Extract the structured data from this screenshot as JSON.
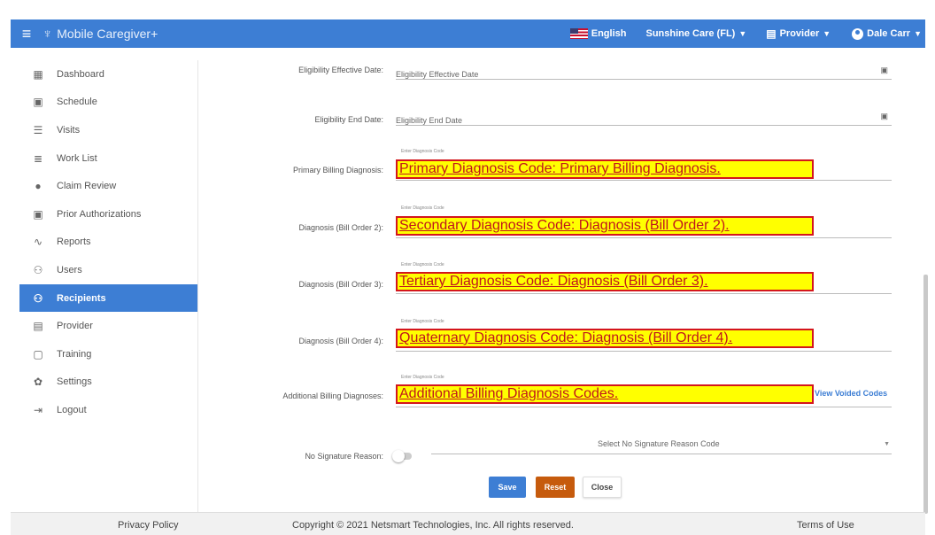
{
  "app": {
    "title": "Mobile Caregiver+"
  },
  "topbar": {
    "language": "English",
    "agency": "Sunshine Care (FL)",
    "role": "Provider",
    "user": "Dale Carr"
  },
  "sidebar": {
    "items": [
      {
        "label": "Dashboard",
        "icon": "dashboard-icon"
      },
      {
        "label": "Schedule",
        "icon": "calendar-icon"
      },
      {
        "label": "Visits",
        "icon": "filter-icon"
      },
      {
        "label": "Work List",
        "icon": "list-icon"
      },
      {
        "label": "Claim Review",
        "icon": "alert-icon"
      },
      {
        "label": "Prior Authorizations",
        "icon": "calendar-check-icon"
      },
      {
        "label": "Reports",
        "icon": "trend-icon"
      },
      {
        "label": "Users",
        "icon": "users-icon"
      },
      {
        "label": "Recipients",
        "icon": "recipients-icon",
        "active": true
      },
      {
        "label": "Provider",
        "icon": "clipboard-icon"
      },
      {
        "label": "Training",
        "icon": "training-icon"
      },
      {
        "label": "Settings",
        "icon": "gear-icon"
      },
      {
        "label": "Logout",
        "icon": "logout-icon"
      }
    ]
  },
  "form": {
    "eligibility_effective": {
      "label": "Eligibility Effective Date:",
      "placeholder": "Eligibility Effective Date"
    },
    "eligibility_end": {
      "label": "Eligibility End Date:",
      "placeholder": "Eligibility End Date"
    },
    "diag_hint": "Enter Diagnosis Code",
    "primary": {
      "label": "Primary Billing Diagnosis:",
      "note": "Primary Diagnosis Code: Primary Billing Diagnosis."
    },
    "diag2": {
      "label": "Diagnosis (Bill Order 2):",
      "note": "Secondary Diagnosis Code: Diagnosis (Bill Order 2)."
    },
    "diag3": {
      "label": "Diagnosis (Bill Order 3):",
      "note": "Tertiary Diagnosis Code: Diagnosis (Bill Order 3)."
    },
    "diag4": {
      "label": "Diagnosis (Bill Order 4):",
      "note": "Quaternary Diagnosis Code: Diagnosis (Bill Order 4)."
    },
    "additional": {
      "label": "Additional Billing Diagnoses:",
      "note": "Additional Billing Diagnosis Codes.",
      "link": "View Voided Codes"
    },
    "no_signature": {
      "label": "No Signature Reason:",
      "placeholder": "Select No Signature Reason Code",
      "toggle_on": false
    }
  },
  "buttons": {
    "save": "Save",
    "reset": "Reset",
    "close": "Close"
  },
  "footer": {
    "privacy": "Privacy Policy",
    "copyright": "Copyright © 2021 Netsmart Technologies, Inc. All rights reserved.",
    "terms": "Terms of Use"
  },
  "colors": {
    "primary": "#3d7ed4",
    "reset": "#c65b0d",
    "highlight": "#ffff00",
    "highlight_border": "#d4161c"
  }
}
